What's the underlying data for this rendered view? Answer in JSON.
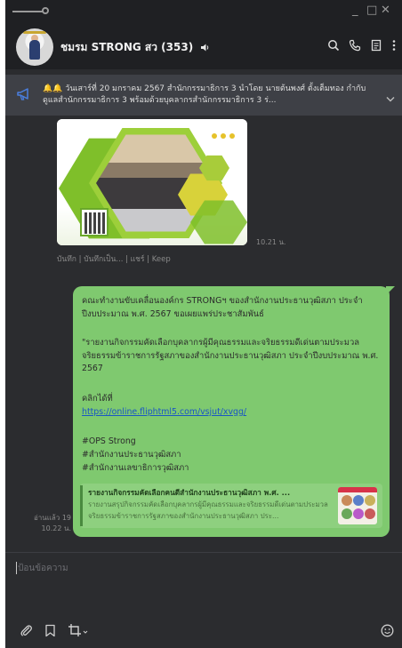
{
  "window": {
    "controls": [
      "_",
      "□",
      "✕"
    ]
  },
  "header": {
    "title": "ชมรม STRONG สว (353)",
    "icons": [
      "mute-icon",
      "search-icon",
      "phone-icon",
      "notes-icon",
      "more-icon"
    ]
  },
  "announcement": {
    "text": "🔔🔔 วันเสาร์ที่ 20 มกราคม 2567 สำนักกรรมาธิการ 3 นำโดย นายต้นพงศ์ ตั้งเต็มทอง กำกับดูแลสำนักกรรมาธิการ 3 พร้อมด้วยบุคลากรสำนักกรรมาธิการ 3 ร่..."
  },
  "image_message": {
    "time": "10.21 น.",
    "actions": "บันทึก | บันทึกเป็น... | แชร์ | Keep"
  },
  "text_message": {
    "p1": "คณะทำงานขับเคลื่อนองค์กร STRONGฯ ของสำนักงานประธานวุฒิสภา ประจำปีงบประมาณ พ.ศ. 2567 ขอเผยแพร่ประชาสัมพันธ์",
    "p2": "\"รายงานกิจกรรมคัดเลือกบุคลากรผู้มีคุณธรรมและจริยธรรมดีเด่นตามประมวลจริยธรรมข้าราชการรัฐสภาของสำนักงานประธานวุฒิสภา ประจำปีงบประมาณ พ.ศ. 2567",
    "click_here": "คลิกได้ที่",
    "link": "https://online.fliphtml5.com/vsjut/xvgg/",
    "tag1": "#OPS Strong",
    "tag2": "#สำนักงานประธานวุฒิสภา",
    "tag3": "#สำนักงานเลขาธิการวุฒิสภา",
    "preview_title": "รายงานกิจกรรมคัดเลือกคนดีสำนักงานประธานวุฒิสภา พ.ศ. ...",
    "preview_desc": "รายงานสรุปกิจกรรมคัดเลือกบุคลากรผู้มีคุณธรรมและจริยธรรมดีเด่นตามประมวลจริยธรรมข้าราชการรัฐสภาของสำนักงานประธานวุฒิสภา ประ...",
    "read_status": "อ่านแล้ว 19",
    "time": "10.22 น."
  },
  "composer": {
    "placeholder": "ป้อนข้อความ"
  },
  "toolbar": {
    "icons": [
      "attach-icon",
      "bookmark-icon",
      "crop-icon",
      "emoji-icon"
    ]
  },
  "colors": {
    "bubble": "#7fc96f",
    "background": "#2b2c2f",
    "link": "#1a56c4"
  }
}
